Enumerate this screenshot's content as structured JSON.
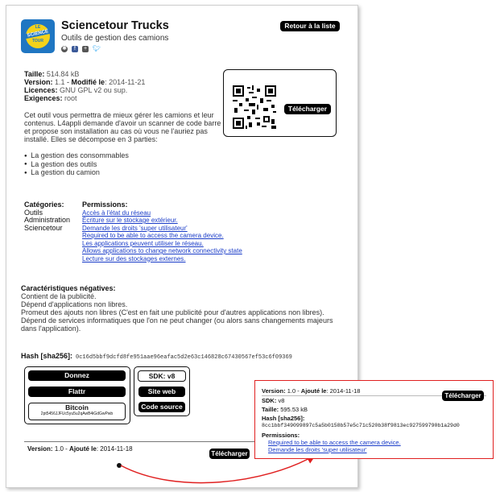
{
  "header": {
    "logo": {
      "line1": "LE",
      "line2": "SCIENCE",
      "line3": "TOUR"
    },
    "title": "Sciencetour Trucks",
    "subtitle": "Outils de gestion des camions",
    "social_icons": [
      "share-icon",
      "facebook-icon",
      "plus-icon",
      "twitter-icon"
    ],
    "back_button": "Retour à la liste"
  },
  "info": {
    "size_label": "Taille:",
    "size_value": "514.84 kB",
    "version_label": "Version:",
    "version_value": "1.1",
    "modified_label": "Modifié le",
    "modified_value": ": 2014-11-21",
    "licence_label": "Licences:",
    "licence_value": "GNU GPL v2 ou sup.",
    "req_label": "Exigences:",
    "req_value": "root"
  },
  "download_button": "Télécharger",
  "description": "Cet outil vous permettra de mieux gérer les camions et leur contenus. L4appli demande d'avoir un scanner de code barre et propose son installation au cas où vous ne l'auriez pas installé. Elles se décompose en 3 parties:",
  "bullets": [
    "La gestion des consommables",
    "La gestion des outils",
    "La gestion du camion"
  ],
  "categories": {
    "label": "Catégories:",
    "items": [
      "Outils",
      "Administration",
      "Sciencetour"
    ]
  },
  "permissions": {
    "label": "Permissions:",
    "items": [
      "Accès à l'état du réseau",
      "Écriture sur le stockage extérieur.",
      "Demande les droits 'super utilisateur'",
      "Required to be able to access the camera device.",
      "Les applications peuvent utiliser le réseau.",
      "Allows applications to change network connectivity state",
      "Lecture sur des stockages externes."
    ]
  },
  "negative": {
    "label": "Caractéristiques négatives:",
    "items": [
      "Contient de la publicité.",
      "Dépend d'applications non libres.",
      "Promeut des ajouts non libres (C'est en fait une publicité pour d'autres applications non libres).",
      "Dépend de services informatiques que l'on ne peut changer (ou alors sans changements majeurs dans l'application)."
    ]
  },
  "hash": {
    "label": "Hash [sha256]:",
    "value": "0c16d5bbf9dcfd8fe951aae96eafac5d2e63c146828c67430567ef53c6f09369"
  },
  "donate": {
    "donnez": "Donnez",
    "flattr": "Flattr",
    "bitcoin": "Bitcoin",
    "bitcoin_address": "2pt5456JJFUc5yu5u2qAwB4iGdGwPwb"
  },
  "sdk": {
    "sdk": "SDK: v8",
    "site": "Site web",
    "source": "Code source"
  },
  "old_version": {
    "version_label": "Version:",
    "version_value": "1.0",
    "added_label": "Ajouté le",
    "added_value": ": 2014-11-18"
  },
  "popup": {
    "version_label": "Version:",
    "version_value": "1.0",
    "added_label": "Ajouté le",
    "added_value": ": 2014-11-18",
    "sdk_label": "SDK:",
    "sdk_value": "v8",
    "size_label": "Taille:",
    "size_value": "595.53 kB",
    "hash_label": "Hash [sha256]:",
    "hash_value": "8cc1bbf349099897c5a5b0158b57e5c71c520b38f9813ec927599790b1a29d0",
    "perm_label": "Permissions:",
    "perms": [
      "Required to be able to access the camera device.",
      "Demande les droits 'super utilisateur'"
    ],
    "download": "Télécharger"
  },
  "colors": {
    "accent": "#1a3cc8",
    "highlight": "#e02020",
    "logo_bg": "#1f76c2",
    "logo_circle": "#f4d21a"
  }
}
